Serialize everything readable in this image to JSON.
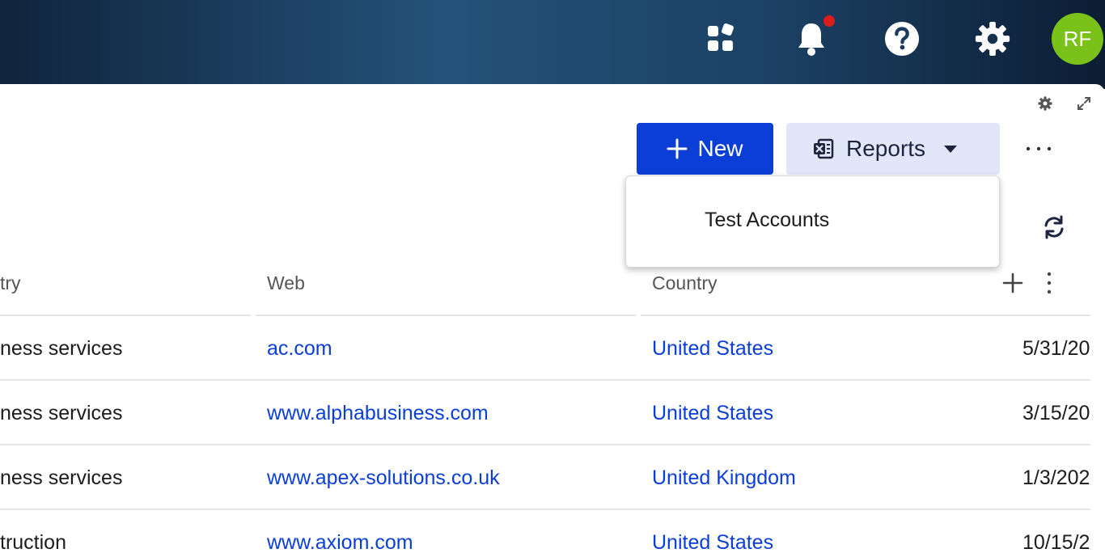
{
  "header": {
    "icons": [
      "apps-icon",
      "bell-icon",
      "help-icon",
      "gear-icon"
    ],
    "notification_dot_color": "#e01b1b",
    "avatar_initials": "RF",
    "avatar_color": "#7ac21a"
  },
  "toolbar": {
    "new_label": "New",
    "reports_label": "Reports",
    "more_label": "···"
  },
  "reports_menu": {
    "items": [
      "Test Accounts"
    ]
  },
  "table": {
    "columns": [
      "try",
      "Web",
      "Country"
    ],
    "rows": [
      {
        "industry": "ness services",
        "web": "ac.com",
        "country": "United States",
        "date": "5/31/20"
      },
      {
        "industry": "ness services",
        "web": "www.alphabusiness.com",
        "country": "United States",
        "date": "3/15/20"
      },
      {
        "industry": "ness services",
        "web": "www.apex-solutions.co.uk",
        "country": "United Kingdom",
        "date": "1/3/202"
      },
      {
        "industry": "truction",
        "web": "www.axiom.com",
        "country": "United States",
        "date": "10/15/2"
      }
    ]
  },
  "colors": {
    "primary": "#0b3ed6",
    "secondary_button_bg": "#e1e7f8",
    "link": "#0b3ed6"
  }
}
